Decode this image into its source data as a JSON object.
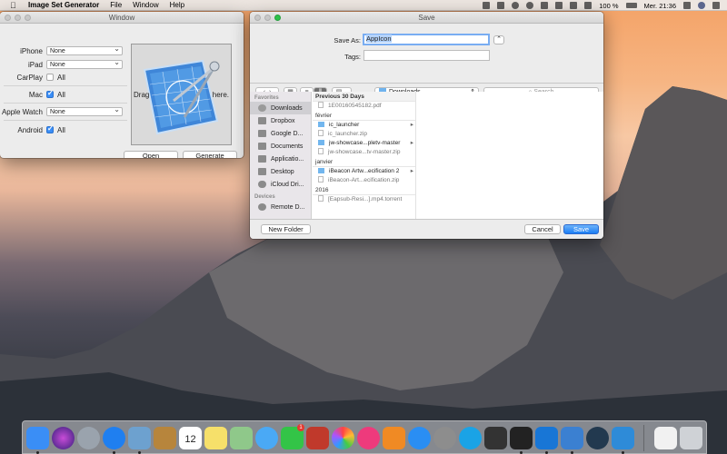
{
  "menubar": {
    "app_name": "Image Set Generator",
    "items": [
      "File",
      "Window",
      "Help"
    ],
    "battery": "100 %",
    "clock": "Mer. 21:36"
  },
  "generator": {
    "title": "Window",
    "rows": [
      {
        "label": "iPhone",
        "type": "select",
        "value": "None"
      },
      {
        "label": "iPad",
        "type": "select",
        "value": "None"
      },
      {
        "label": "CarPlay",
        "type": "check",
        "checked": false,
        "value": "All"
      },
      {
        "label": "Mac",
        "type": "check",
        "checked": true,
        "value": "All"
      },
      {
        "label": "Apple Watch",
        "type": "select",
        "value": "None"
      },
      {
        "label": "Android",
        "type": "check",
        "checked": true,
        "value": "All"
      }
    ],
    "drop_text_left": "Drag",
    "drop_text_right": "here.",
    "open_label": "Open",
    "generate_label": "Generate"
  },
  "save": {
    "title": "Save",
    "save_as_label": "Save As:",
    "save_as_value": "AppIcon",
    "tags_label": "Tags:",
    "location": "Downloads",
    "search_placeholder": "Search",
    "sidebar_heading_favorites": "Favorites",
    "favorites": [
      "Downloads",
      "Dropbox",
      "Google D...",
      "Documents",
      "Applicatio...",
      "Desktop",
      "iCloud Dri..."
    ],
    "sidebar_heading_devices": "Devices",
    "devices": [
      "Remote D..."
    ],
    "groups": [
      {
        "heading": "Previous 30 Days",
        "files": [
          {
            "name": "1E00160545182.pdf",
            "kind": "doc",
            "dim": true
          }
        ]
      },
      {
        "heading": "février",
        "files": [
          {
            "name": "ic_launcher",
            "kind": "folder",
            "dim": false
          },
          {
            "name": "ic_launcher.zip",
            "kind": "doc",
            "dim": true
          },
          {
            "name": "jw-showcase...pletv-master",
            "kind": "folder",
            "dim": false
          },
          {
            "name": "jw-showcase...tv-master.zip",
            "kind": "doc",
            "dim": true
          }
        ]
      },
      {
        "heading": "janvier",
        "files": [
          {
            "name": "iBeacon Artw...ecification 2",
            "kind": "folder",
            "dim": false
          },
          {
            "name": "iBeacon-Art...ecification.zip",
            "kind": "doc",
            "dim": true
          }
        ]
      },
      {
        "heading": "2016",
        "files": [
          {
            "name": "[Eapsub-Resi...].mp4.torrent",
            "kind": "doc",
            "dim": true
          }
        ]
      }
    ],
    "new_folder_label": "New Folder",
    "cancel_label": "Cancel",
    "save_label": "Save"
  },
  "dock": {
    "badges": [
      "1"
    ],
    "calendar_day": "12",
    "colors": {
      "finder": "#3a8ef6",
      "siri": "#6b3fd6",
      "rocket": "#9aa3ad",
      "safari": "#1f7ff0",
      "preview": "#6da1cf",
      "contacts": "#b7853c",
      "calendar": "#ffffff",
      "notes": "#f6e06a",
      "maps": "#8fc88a",
      "messages": "#4aa9f5",
      "facetime": "#33c447",
      "photo_booth": "#c0392b",
      "photos": "#f3f3f3",
      "itunes": "#ee3a7c",
      "ibooks": "#f08a24",
      "app_store": "#2a8ef3",
      "prefs": "#8d8d8d",
      "skype": "#1aa3e6",
      "activity": "#333333",
      "terminal": "#222222",
      "xcode": "#1876d6",
      "folder_blue": "#3b80d1",
      "trash": "#cfd2d6"
    }
  }
}
